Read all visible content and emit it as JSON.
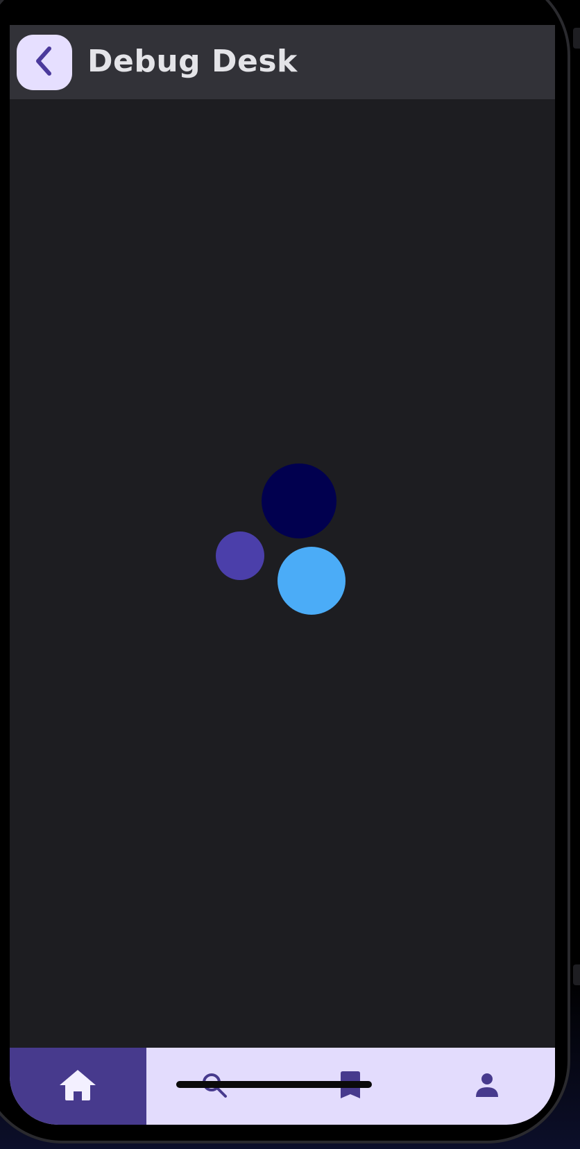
{
  "app": {
    "title": "Debug Desk"
  },
  "header": {
    "back_icon": "chevron-left-icon"
  },
  "loader": {
    "dots": [
      {
        "name": "loader-dot-navy",
        "color": "#01004f"
      },
      {
        "name": "loader-dot-purple",
        "color": "#4b3faa"
      },
      {
        "name": "loader-dot-blue",
        "color": "#4bacf7"
      }
    ]
  },
  "bottom_nav": {
    "items": [
      {
        "name": "nav-home",
        "icon": "home-icon",
        "active": true
      },
      {
        "name": "nav-search",
        "icon": "search-icon",
        "active": false
      },
      {
        "name": "nav-bookmarks",
        "icon": "bookmark-icon",
        "active": false
      },
      {
        "name": "nav-profile",
        "icon": "person-icon",
        "active": false
      }
    ]
  },
  "colors": {
    "background": "#1d1d21",
    "app_bar": "#323238",
    "accent": "#473a8d",
    "nav_background": "#e3dcfd",
    "back_button_background": "#e6dfff"
  }
}
